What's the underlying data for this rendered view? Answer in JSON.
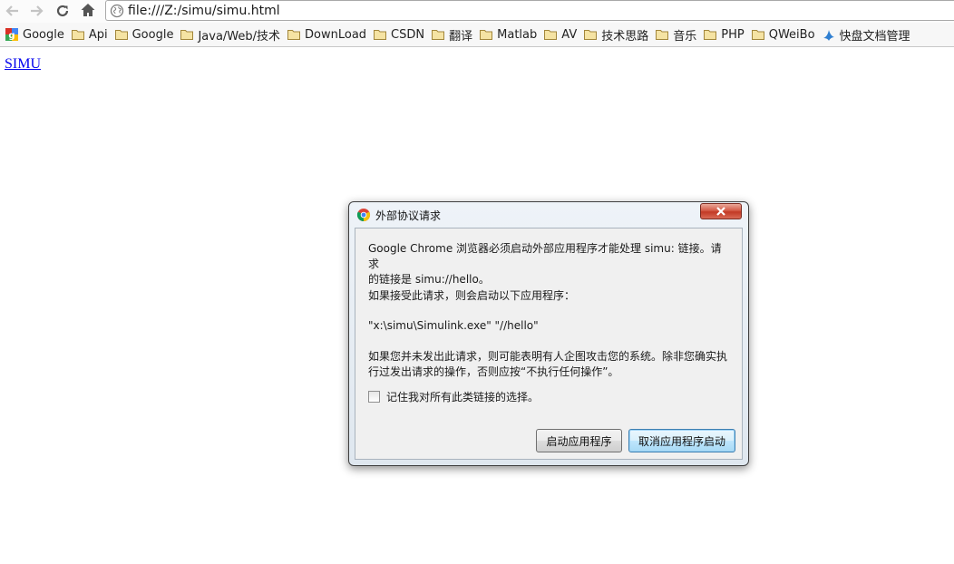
{
  "browser": {
    "back_icon": "back-arrow-icon",
    "forward_icon": "forward-arrow-icon",
    "reload_icon": "reload-icon",
    "home_icon": "home-icon",
    "url": "file:///Z:/simu/simu.html",
    "bookmarks": [
      {
        "label": "Google",
        "icon": "google-icon"
      },
      {
        "label": "Api",
        "icon": "folder-icon"
      },
      {
        "label": "Google",
        "icon": "folder-icon"
      },
      {
        "label": "Java/Web/技术",
        "icon": "folder-icon"
      },
      {
        "label": "DownLoad",
        "icon": "folder-icon"
      },
      {
        "label": "CSDN",
        "icon": "folder-icon"
      },
      {
        "label": "翻译",
        "icon": "folder-icon"
      },
      {
        "label": "Matlab",
        "icon": "folder-icon"
      },
      {
        "label": "AV",
        "icon": "folder-icon"
      },
      {
        "label": "技术思路",
        "icon": "folder-icon"
      },
      {
        "label": "音乐",
        "icon": "folder-icon"
      },
      {
        "label": "PHP",
        "icon": "folder-icon"
      },
      {
        "label": "QWeiBo",
        "icon": "folder-icon"
      },
      {
        "label": "快盘文档管理",
        "icon": "kuaipan-icon"
      }
    ]
  },
  "page": {
    "link_text": "SIMU"
  },
  "dialog": {
    "title": "外部协议请求",
    "message_line1": "Google Chrome 浏览器必须启动外部应用程序才能处理 simu: 链接。请求",
    "message_line2": "的链接是 simu://hello。",
    "message_accept": "如果接受此请求，则会启动以下应用程序：",
    "command": "\"x:\\simu\\Simulink.exe\" \"//hello\"",
    "warning_line1": "如果您并未发出此请求，则可能表明有人企图攻击您的系统。除非您确实执",
    "warning_line2": "行过发出请求的操作，否则应按“不执行任何操作”。",
    "remember_label": "记住我对所有此类链接的选择。",
    "launch_button": "启动应用程序",
    "cancel_button": "取消应用程序启动"
  },
  "colors": {
    "link": "#0000ee",
    "close_button": "#c23a25",
    "default_button_border": "#3c7fb1"
  }
}
